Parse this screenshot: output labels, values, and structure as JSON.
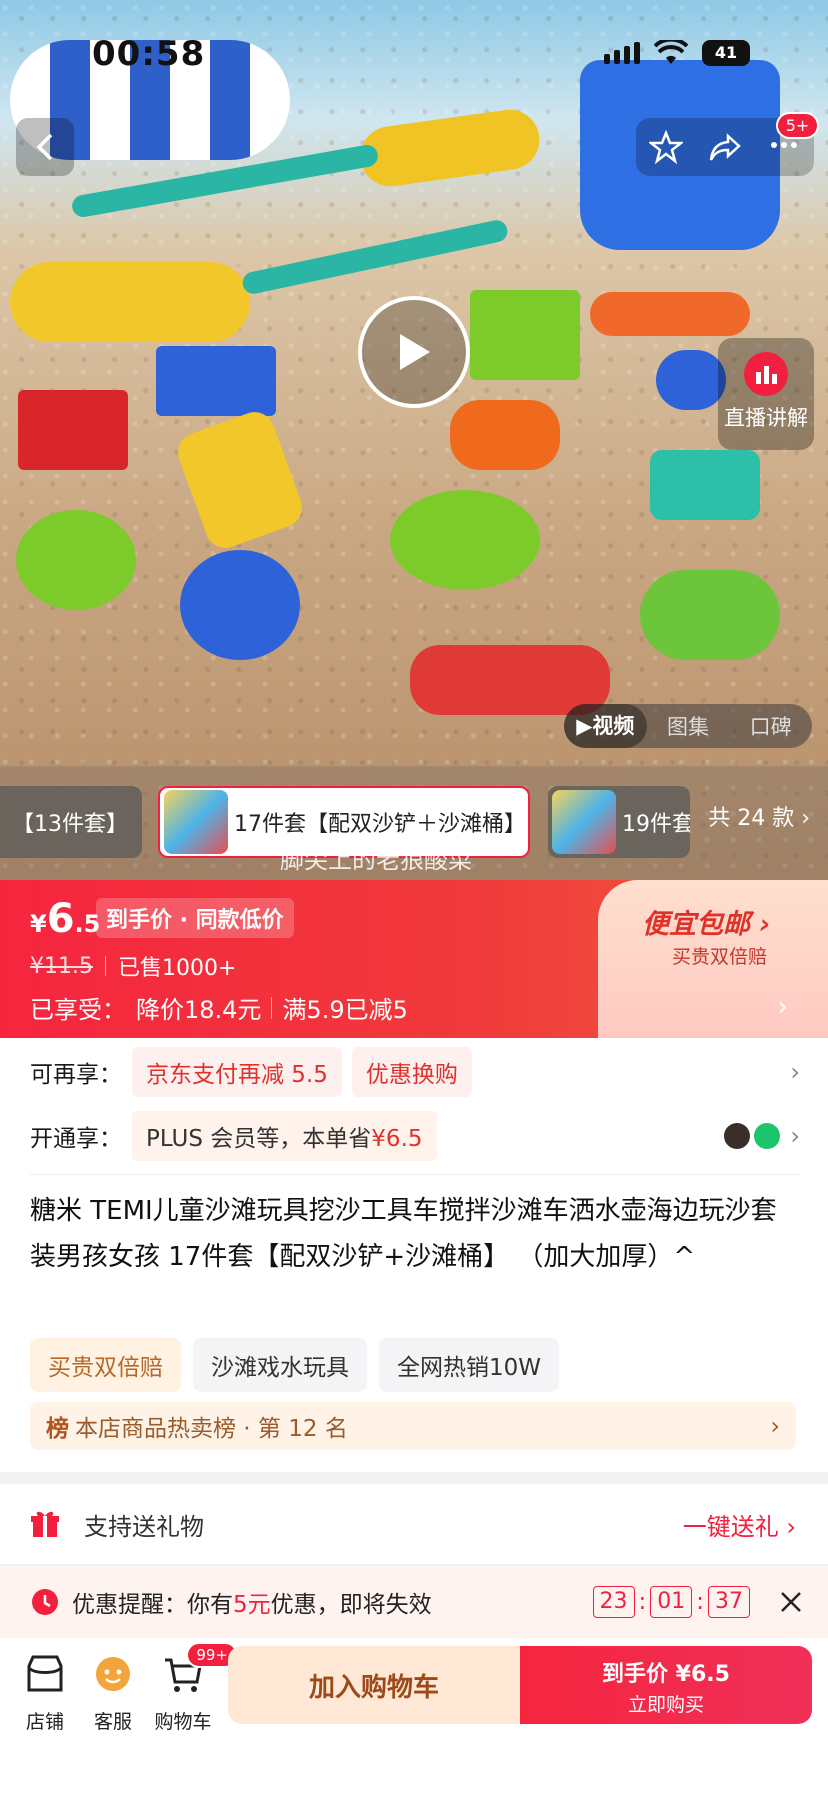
{
  "status": {
    "time": "00:58",
    "battery": "41"
  },
  "nav": {
    "notif_badge": "5+"
  },
  "hero": {
    "live_label": "直播讲解",
    "media_tabs": [
      "▶视频",
      "图集",
      "口碑"
    ],
    "watermark": "脚尖上的老狼酸菜"
  },
  "variants": {
    "items": [
      "【13件套】",
      "17件套【配双沙铲＋沙滩桶】",
      "19件套"
    ],
    "count_label": "共 24 款 ›"
  },
  "price": {
    "yen": "¥",
    "int": "6",
    "dec": ".5",
    "tag": "到手价 · 同款低价",
    "original": "¥11.5",
    "sold": "已售1000+",
    "enjoyed_label": "已享受：",
    "enjoyed_discount": "降价18.4元",
    "enjoyed_coupon": "满5.9已减5",
    "cheap_title": "便宜包邮 ›",
    "cheap_sub": "买贵双倍赔"
  },
  "benefits": {
    "more_label": "可再享：",
    "more_chips": [
      "京东支付再减 5.5",
      "优惠换购"
    ],
    "plus_label": "开通享：",
    "plus_text": "PLUS 会员等，本单省",
    "plus_amount": "¥6.5"
  },
  "product": {
    "title": "糖米 TEMI儿童沙滩玩具挖沙工具车搅拌沙滩车洒水壶海边玩沙套装男孩女孩 17件套【配双沙铲+沙滩桶】 （加大加厚）^",
    "tags": [
      "买贵双倍赔",
      "沙滩戏水玩具",
      "全网热销10W"
    ],
    "rank_mark": "榜",
    "rank_text": "本店商品热卖榜 · 第 12 名"
  },
  "gift": {
    "label": "支持送礼物",
    "action": "一键送礼 ›"
  },
  "promo": {
    "prefix": "优惠提醒：你有",
    "amount": "5元",
    "suffix": "优惠，即将失效",
    "timer": [
      "23",
      "01",
      "37"
    ]
  },
  "bottom": {
    "store": "店铺",
    "service": "客服",
    "cart": "购物车",
    "cart_badge": "99+",
    "add_cart": "加入购物车",
    "buy_price": "到手价 ¥6.5",
    "buy_now": "立即购买"
  }
}
